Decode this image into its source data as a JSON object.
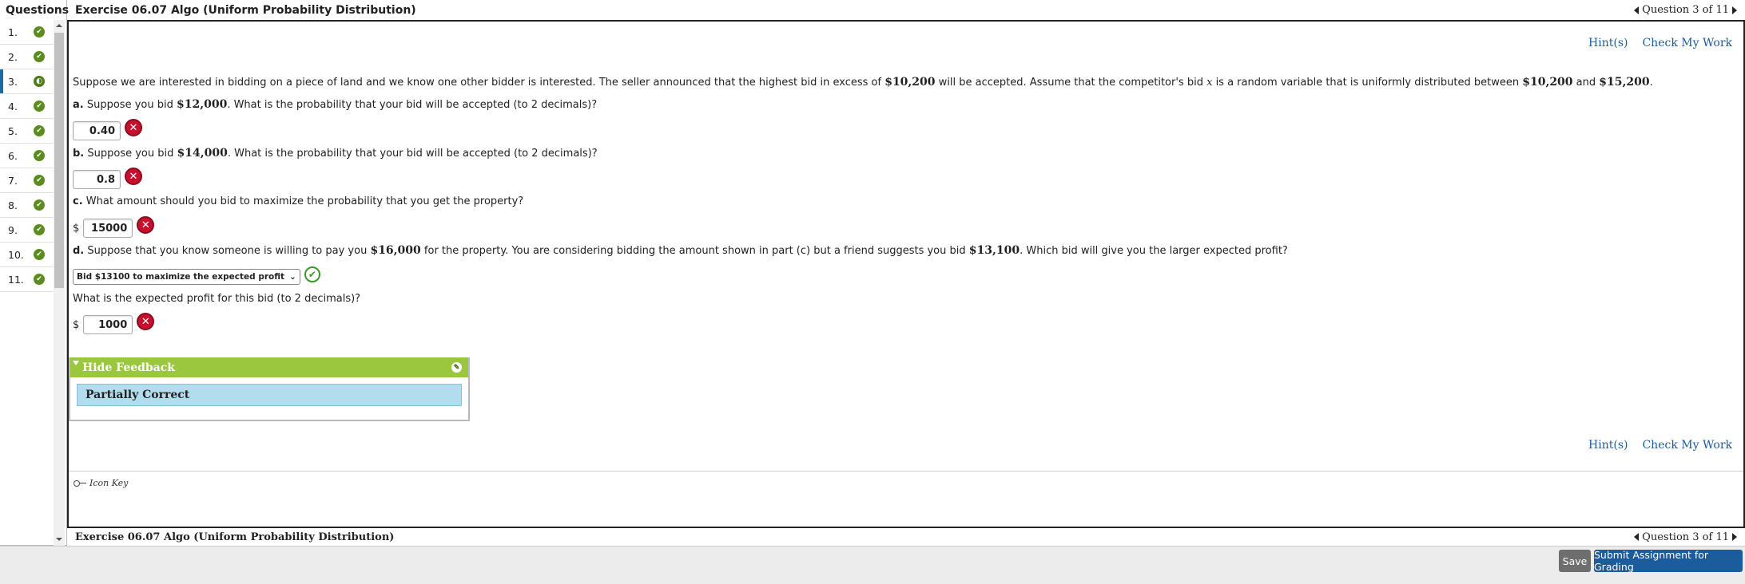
{
  "sidebar": {
    "title": "Questions",
    "items": [
      {
        "num": "1.",
        "status": "check"
      },
      {
        "num": "2.",
        "status": "check"
      },
      {
        "num": "3.",
        "status": "partial"
      },
      {
        "num": "4.",
        "status": "check"
      },
      {
        "num": "5.",
        "status": "check"
      },
      {
        "num": "6.",
        "status": "check"
      },
      {
        "num": "7.",
        "status": "check"
      },
      {
        "num": "8.",
        "status": "check"
      },
      {
        "num": "9.",
        "status": "check"
      },
      {
        "num": "10.",
        "status": "check"
      },
      {
        "num": "11.",
        "status": "check"
      }
    ]
  },
  "header": {
    "title": "Exercise 06.07 Algo (Uniform Probability Distribution)",
    "question_nav": "Question 3 of 11"
  },
  "links": {
    "hint": "Hint(s)",
    "check": "Check My Work"
  },
  "problem": {
    "intro_1": "Suppose we are interested in bidding on a piece of land and we know one other bidder is interested. The seller announced that the highest bid in excess of ",
    "amount_1": "$10,200",
    "intro_2": " will be accepted. Assume that the competitor's bid ",
    "var": "x",
    "intro_3": " is a random variable that is uniformly distributed between ",
    "amount_2": "$10,200",
    "intro_4": " and ",
    "amount_3": "$15,200",
    "intro_5": ".",
    "a_label": "a.",
    "a_pre": " Suppose you bid ",
    "a_amount": "$12,000",
    "a_post": ". What is the probability that your bid will be accepted (to 2 decimals)?",
    "a_answer": "0.40",
    "b_label": "b.",
    "b_pre": " Suppose you bid ",
    "b_amount": "$14,000",
    "b_post": ". What is the probability that your bid will be accepted (to 2 decimals)?",
    "b_answer": "0.8",
    "c_label": "c.",
    "c_text": " What amount should you bid to maximize the probability that you get the property?",
    "currency": "$",
    "c_answer": "15000",
    "d_label": "d.",
    "d_pre": " Suppose that you know someone is willing to pay you ",
    "d_amount_1": "$16,000",
    "d_mid": " for the property. You are considering bidding the amount shown in part (c) but a friend suggests you bid ",
    "d_amount_2": "$13,100",
    "d_post": ". Which bid will give you the larger expected profit?",
    "d_select": "Bid $13100 to maximize the expected profit",
    "e_text": "What is the expected profit for this bid (to 2 decimals)?",
    "e_answer": "1000"
  },
  "feedback": {
    "toggle": "Hide Feedback",
    "result": "Partially Correct"
  },
  "icon_key": "Icon Key",
  "footer": {
    "save": "Save",
    "submit": "Submit Assignment for Grading"
  }
}
